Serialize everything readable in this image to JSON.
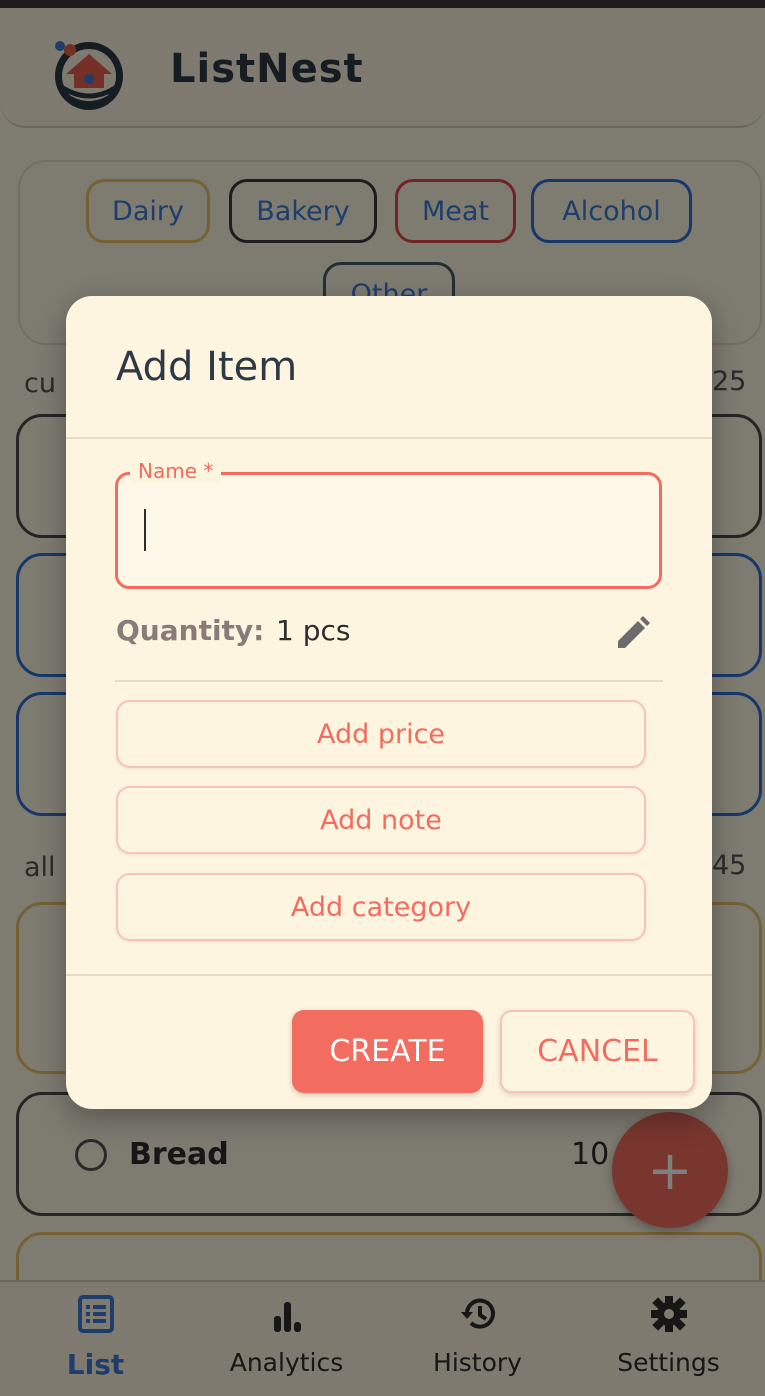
{
  "app": {
    "title": "ListNest"
  },
  "categories": [
    "Dairy",
    "Bakery",
    "Meat",
    "Alcohol",
    "Other"
  ],
  "sections": {
    "current": {
      "label": "cu",
      "count": "25"
    },
    "all": {
      "label": "all",
      "count": "45"
    }
  },
  "list_items": [
    {
      "name": "Bread",
      "price": "10"
    }
  ],
  "fab": {
    "icon": "plus-icon",
    "label": "+"
  },
  "bottom_nav": [
    {
      "label": "List",
      "icon": "list-icon",
      "active": true
    },
    {
      "label": "Analytics",
      "icon": "analytics-icon",
      "active": false
    },
    {
      "label": "History",
      "icon": "history-icon",
      "active": false
    },
    {
      "label": "Settings",
      "icon": "settings-icon",
      "active": false
    }
  ],
  "dialog": {
    "title": "Add Item",
    "name_field": {
      "label": "Name *",
      "value": ""
    },
    "quantity": {
      "label": "Quantity:",
      "value": "1 pcs"
    },
    "options": {
      "price": "Add price",
      "note": "Add note",
      "category": "Add category"
    },
    "create_label": "CREATE",
    "cancel_label": "CANCEL"
  },
  "colors": {
    "accent": "#f26c5f",
    "background": "#fdf6e3",
    "nav_active": "#3a7bd5"
  }
}
